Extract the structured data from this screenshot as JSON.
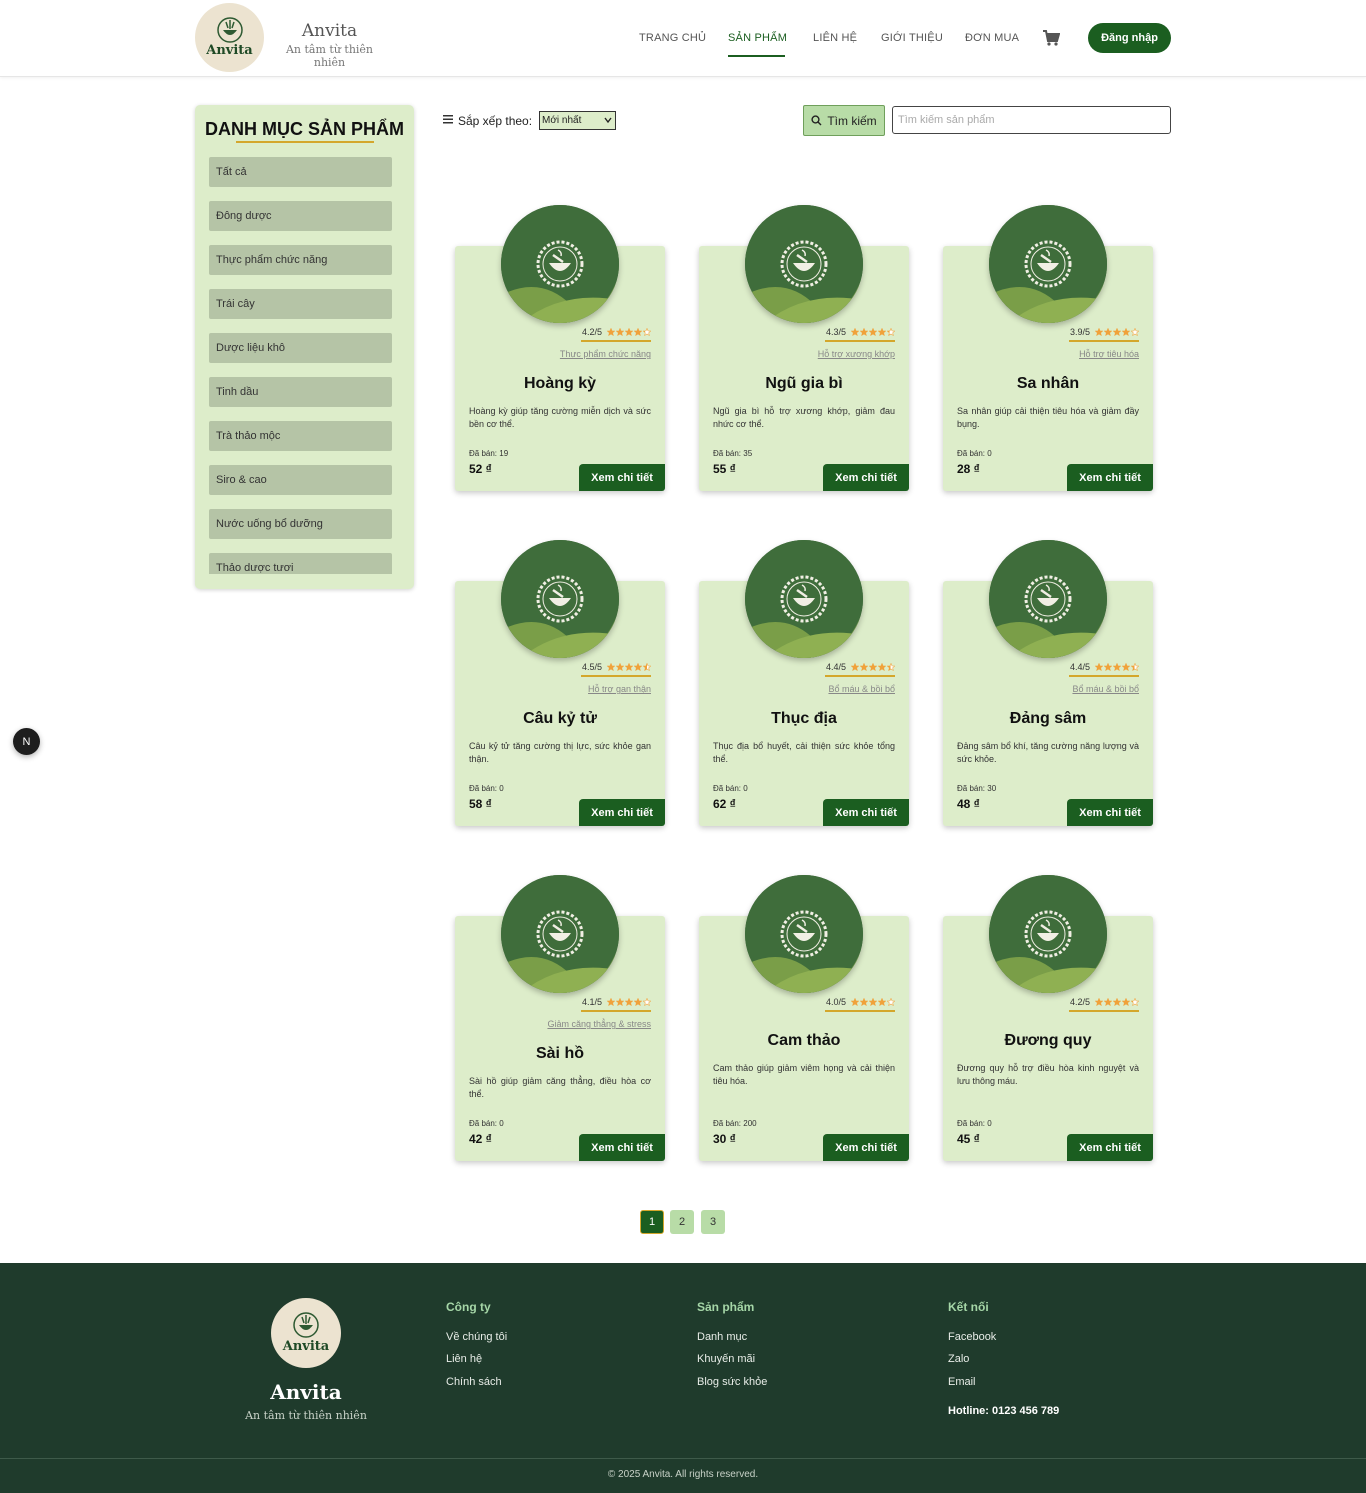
{
  "header": {
    "brand_name": "Anvita",
    "tagline": "An tâm từ thiên nhiên",
    "logo_word": "Anvita",
    "nav": [
      "TRANG CHỦ",
      "SẢN PHẨM",
      "LIÊN HỆ",
      "GIỚI THIỆU",
      "ĐƠN MUA"
    ],
    "active_nav": "SẢN PHẨM",
    "cart_icon": "shopping-cart-icon",
    "login_label": "Đăng nhập"
  },
  "sidebar": {
    "title": "DANH MỤC SẢN PHẨM",
    "items": [
      "Tất cả",
      "Đông dược",
      "Thực phẩm chức năng",
      "Trái cây",
      "Dược liệu khô",
      "Tinh dầu",
      "Trà thảo mộc",
      "Siro & cao",
      "Nước uống bổ dưỡng",
      "Thảo dược tươi"
    ]
  },
  "toolbar": {
    "sort_label": "Sắp xếp theo:",
    "sort_value": "Mới nhất",
    "search_label": "Tìm kiếm",
    "search_placeholder": "Tìm kiếm sản phẩm"
  },
  "products": [
    {
      "rating": "4.2/5",
      "stars": 4.2,
      "category": "Thực phẩm chức năng",
      "name": "Hoàng kỳ",
      "desc": "Hoàng kỳ giúp tăng cường miễn dịch và sức bền cơ thể.",
      "sold": "Đã bán: 19",
      "price": "52 ₫",
      "button": "Xem chi tiết"
    },
    {
      "rating": "4.3/5",
      "stars": 4.3,
      "category": "Hỗ trợ xương khớp",
      "name": "Ngũ gia bì",
      "desc": "Ngũ gia bì hỗ trợ xương khớp, giảm đau nhức cơ thể.",
      "sold": "Đã bán: 35",
      "price": "55 ₫",
      "button": "Xem chi tiết"
    },
    {
      "rating": "3.9/5",
      "stars": 3.9,
      "category": "Hỗ trợ tiêu hóa",
      "name": "Sa nhân",
      "desc": "Sa nhân giúp cải thiện tiêu hóa và giảm đầy bụng.",
      "sold": "Đã bán: 0",
      "price": "28 ₫",
      "button": "Xem chi tiết"
    },
    {
      "rating": "4.5/5",
      "stars": 4.5,
      "category": "Hỗ trợ gan thận",
      "name": "Câu kỷ tử",
      "desc": "Câu kỷ tử tăng cường thị lực, sức khỏe gan thận.",
      "sold": "Đã bán: 0",
      "price": "58 ₫",
      "button": "Xem chi tiết"
    },
    {
      "rating": "4.4/5",
      "stars": 4.4,
      "category": "Bổ máu & bồi bổ",
      "name": "Thục địa",
      "desc": "Thục địa bổ huyết, cải thiện sức khỏe tổng thể.",
      "sold": "Đã bán: 0",
      "price": "62 ₫",
      "button": "Xem chi tiết"
    },
    {
      "rating": "4.4/5",
      "stars": 4.4,
      "category": "Bổ máu & bồi bổ",
      "name": "Đảng sâm",
      "desc": "Đảng sâm bổ khí, tăng cường năng lượng và sức khỏe.",
      "sold": "Đã bán: 30",
      "price": "48 ₫",
      "button": "Xem chi tiết"
    },
    {
      "rating": "4.1/5",
      "stars": 4.1,
      "category": "Giảm căng thẳng & stress",
      "name": "Sài hồ",
      "desc": "Sài hồ giúp giảm căng thẳng, điều hòa cơ thể.",
      "sold": "Đã bán: 0",
      "price": "42 ₫",
      "button": "Xem chi tiết"
    },
    {
      "rating": "4.0/5",
      "stars": 4.0,
      "category": "",
      "name": "Cam thảo",
      "desc": "Cam thảo giúp giảm viêm họng và cải thiện tiêu hóa.",
      "sold": "Đã bán: 200",
      "price": "30 ₫",
      "button": "Xem chi tiết"
    },
    {
      "rating": "4.2/5",
      "stars": 4.2,
      "category": "",
      "name": "Đương quy",
      "desc": "Đương quy hỗ trợ điều hòa kinh nguyệt và lưu thông máu.",
      "sold": "Đã bán: 0",
      "price": "45 ₫",
      "button": "Xem chi tiết"
    }
  ],
  "pagination": {
    "pages": [
      "1",
      "2",
      "3"
    ],
    "current": "1"
  },
  "floating_badge": "N",
  "footer": {
    "logo_word": "Anvita",
    "brand_name": "Anvita",
    "tagline": "An tâm từ thiên nhiên",
    "columns": [
      {
        "title": "Công ty",
        "links": [
          "Về chúng tôi",
          "Liên hệ",
          "Chính sách"
        ]
      },
      {
        "title": "Sản phẩm",
        "links": [
          "Danh mục",
          "Khuyến mãi",
          "Blog sức khỏe"
        ]
      },
      {
        "title": "Kết nối",
        "links": [
          "Facebook",
          "Zalo",
          "Email"
        ]
      }
    ],
    "hotline": "Hotline: 0123 456 789",
    "copyright": "© 2025 Anvita. All rights reserved."
  },
  "colors": {
    "primary": "#1b5e20",
    "card_bg": "#ddedca",
    "accent": "#d4a72c",
    "footer_bg": "#1f3b2c"
  }
}
